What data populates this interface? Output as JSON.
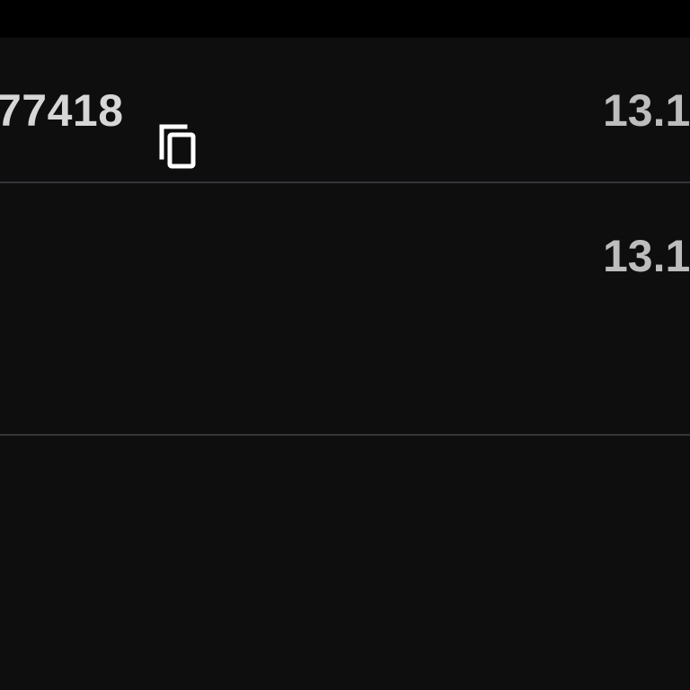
{
  "colors": {
    "background": "#0e0e0f",
    "top_bar": "#000000",
    "divider": "#353537",
    "primary_text": "#d6d6d6",
    "secondary_text": "#bdbdbd",
    "icon": "#ffffff"
  },
  "rows": [
    {
      "id_text": "77418",
      "copy_icon": "copy-icon",
      "value": "13.1"
    },
    {
      "value": "13.1"
    }
  ]
}
